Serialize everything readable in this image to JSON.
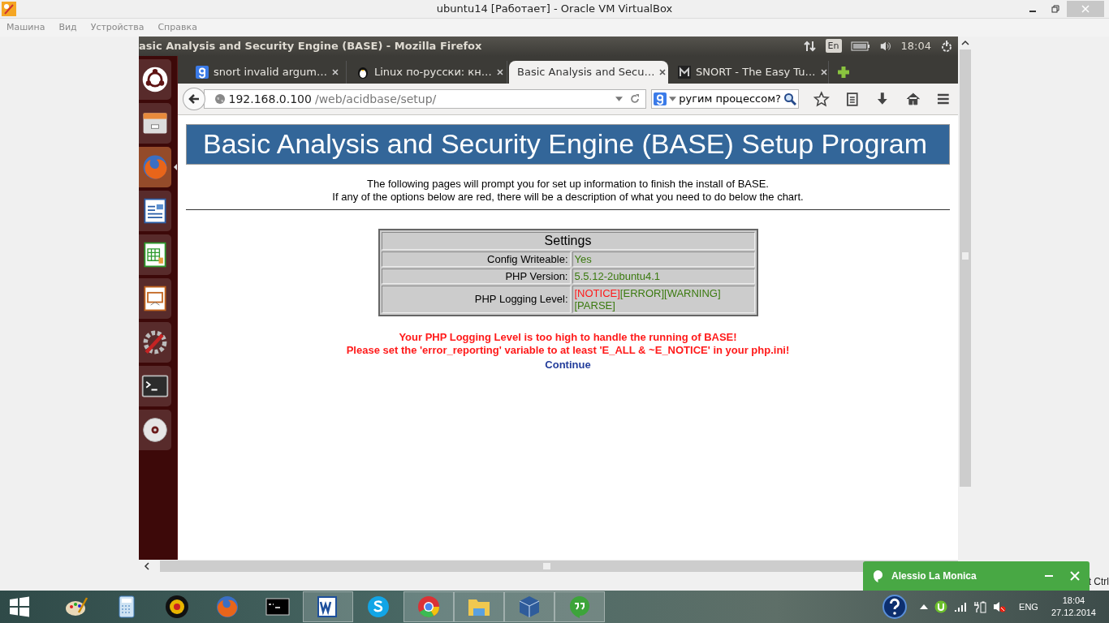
{
  "host_window": {
    "title": "ubuntu14 [Работает] - Oracle VM VirtualBox",
    "menu": [
      "Машина",
      "Вид",
      "Устройства",
      "Справка"
    ],
    "host_key_hint": "t Ctrl"
  },
  "guest_panel": {
    "title": "asic Analysis and Security Engine (BASE) - Mozilla Firefox",
    "keyboard_layout": "En",
    "time": "18:04"
  },
  "launcher": {
    "items": [
      {
        "kind": "ubuntu",
        "active": false
      },
      {
        "kind": "files",
        "active": false
      },
      {
        "kind": "firefox",
        "active": true
      },
      {
        "kind": "writer",
        "active": false
      },
      {
        "kind": "calc",
        "active": false
      },
      {
        "kind": "impress",
        "active": false
      },
      {
        "kind": "settings",
        "active": false
      },
      {
        "kind": "terminal",
        "active": false
      },
      {
        "kind": "disc",
        "active": false
      }
    ]
  },
  "browser": {
    "tabs": [
      {
        "title": "snort invalid argum…",
        "kind": "google",
        "selected": false
      },
      {
        "title": "Linux по-русски: кн…",
        "kind": "penguin",
        "selected": false
      },
      {
        "title": "Basic Analysis and Secu…",
        "kind": "plain",
        "selected": true
      },
      {
        "title": "SNORT - The Easy Tu…",
        "kind": "pig",
        "selected": false
      }
    ],
    "address": {
      "host": "192.168.0.100",
      "path": "/web/acidbase/setup/"
    },
    "search": {
      "value": "ругим процессом?"
    }
  },
  "page": {
    "heading": "Basic Analysis and Security Engine (BASE) Setup Program",
    "intro": [
      "The following pages will prompt you for set up information to finish the install of BASE.",
      "If any of the options below are red, there will be a description of what you need to do below the chart."
    ],
    "settings": {
      "title": "Settings",
      "rows": [
        {
          "label": "Config Writeable:",
          "values": [
            {
              "text": "Yes",
              "color": "#3b7a0f"
            }
          ]
        },
        {
          "label": "PHP Version:",
          "values": [
            {
              "text": "5.5.12-2ubuntu4.1",
              "color": "#3b7a0f"
            }
          ]
        },
        {
          "label": "PHP Logging Level:",
          "values": [
            {
              "text": "[NOTICE]",
              "color": "#ff1a1a"
            },
            {
              "text": "[ERROR]",
              "color": "#3b7a0f"
            },
            {
              "text": "[WARNING]",
              "color": "#3b7a0f"
            },
            {
              "text": "[PARSE]",
              "color": "#3b7a0f"
            }
          ]
        }
      ]
    },
    "errors": [
      "Your PHP Logging Level is too high to handle the running of BASE!",
      "Please set the 'error_reporting' variable to at least 'E_ALL & ~E_NOTICE' in your php.ini!"
    ],
    "continue_link": "Continue"
  },
  "notification": {
    "sender": "Alessio La Monica"
  },
  "taskbar": {
    "apps": [
      {
        "kind": "paint",
        "open": false
      },
      {
        "kind": "calculator",
        "open": false
      },
      {
        "kind": "webcam",
        "open": false
      },
      {
        "kind": "firefox",
        "open": false
      },
      {
        "kind": "cmd",
        "open": false
      },
      {
        "kind": "word",
        "open": true
      },
      {
        "kind": "skype",
        "open": false
      },
      {
        "kind": "chrome",
        "open": true
      },
      {
        "kind": "folder",
        "open": true
      },
      {
        "kind": "virtualbox",
        "open": true
      },
      {
        "kind": "hangouts",
        "open": true
      }
    ],
    "language": "ENG",
    "time": "18:04",
    "date": "27.12.2014"
  }
}
